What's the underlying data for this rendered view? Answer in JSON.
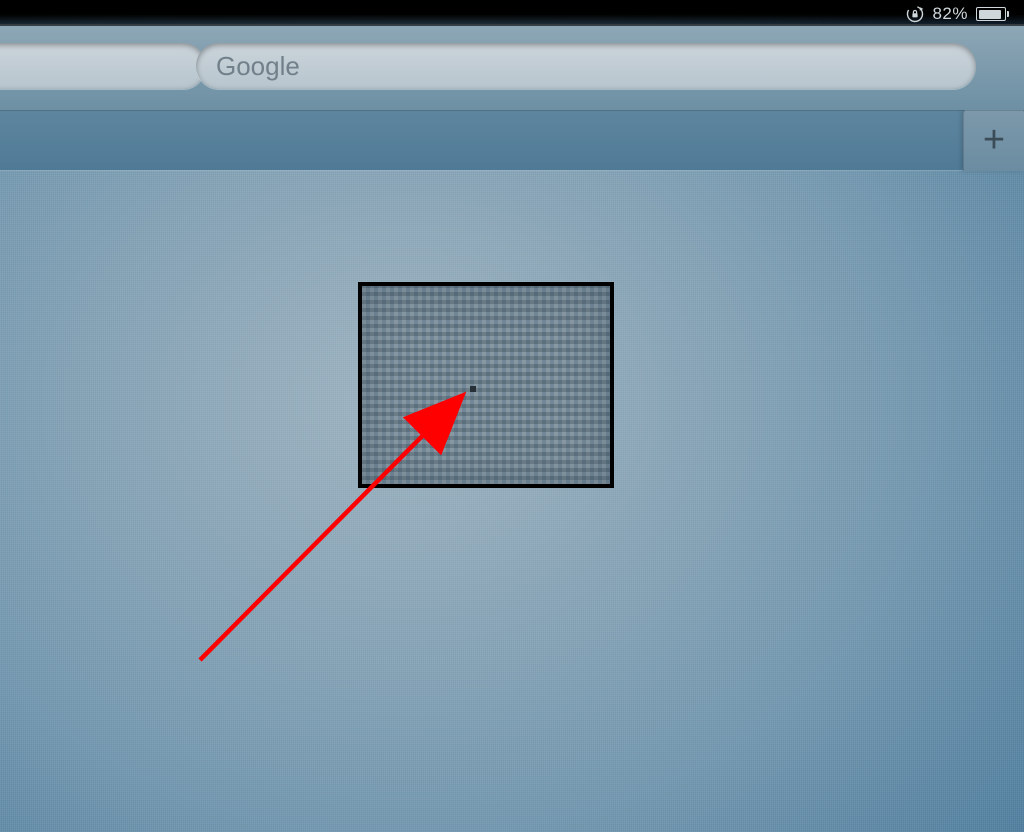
{
  "status_bar": {
    "battery_percent": "82%",
    "orientation_lock_icon": "orientation-lock"
  },
  "toolbar": {
    "url_value": "",
    "search_placeholder": "Google"
  },
  "tabbar": {
    "new_tab_glyph": "+"
  },
  "annotation": {
    "type": "callout-arrow",
    "label": "",
    "arrow_color": "#ff0000",
    "box_color": "#000000"
  }
}
